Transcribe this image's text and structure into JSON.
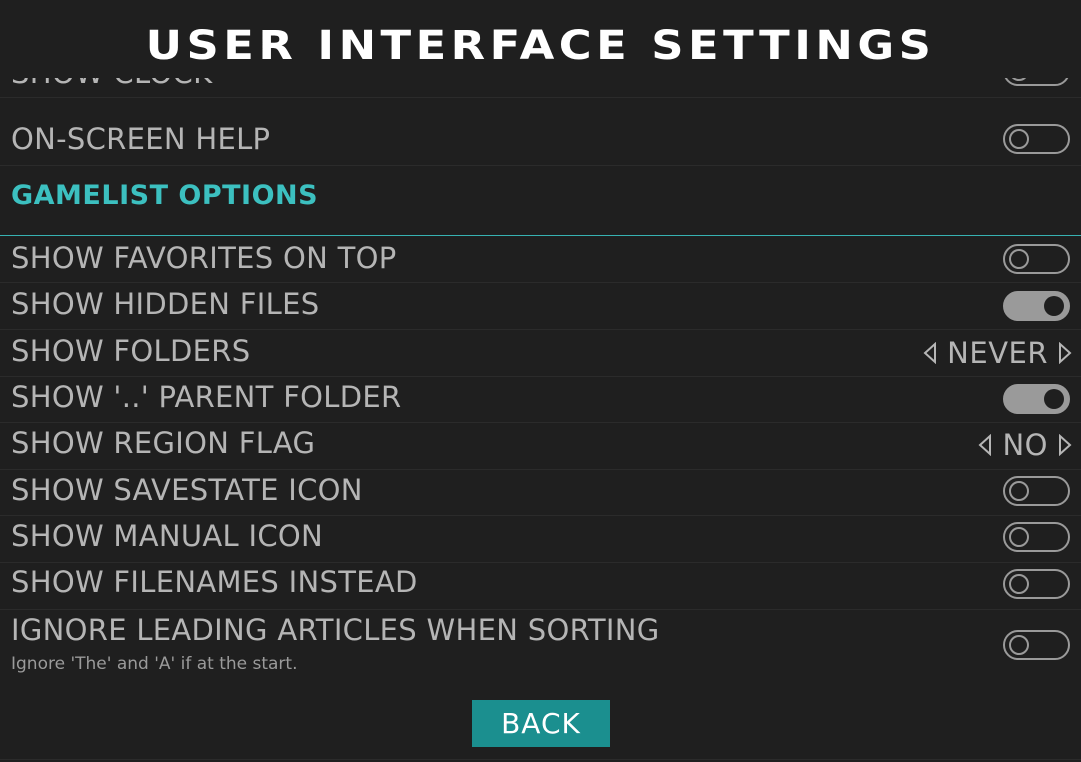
{
  "header": {
    "title": "USER INTERFACE SETTINGS"
  },
  "settings": {
    "partial_row": {
      "label": "SHOW CLOCK",
      "state": "off"
    },
    "on_screen_help": {
      "label": "ON-SCREEN HELP",
      "state": "off"
    },
    "section_title": "GAMELIST OPTIONS",
    "items": [
      {
        "label": "SHOW FAVORITES ON TOP",
        "type": "toggle",
        "state": "off"
      },
      {
        "label": "SHOW HIDDEN FILES",
        "type": "toggle",
        "state": "on"
      },
      {
        "label": "SHOW FOLDERS",
        "type": "selector",
        "value": "NEVER"
      },
      {
        "label": "SHOW '..' PARENT FOLDER",
        "type": "toggle",
        "state": "on"
      },
      {
        "label": "SHOW REGION FLAG",
        "type": "selector",
        "value": "NO"
      },
      {
        "label": "SHOW SAVESTATE ICON",
        "type": "toggle",
        "state": "off"
      },
      {
        "label": "SHOW MANUAL ICON",
        "type": "toggle",
        "state": "off"
      },
      {
        "label": "SHOW FILENAMES INSTEAD",
        "type": "toggle",
        "state": "off"
      },
      {
        "label": "IGNORE LEADING ARTICLES WHEN SORTING",
        "type": "toggle",
        "state": "off",
        "description": "Ignore 'The' and 'A' if at the start."
      }
    ]
  },
  "footer": {
    "back_label": "BACK"
  },
  "colors": {
    "background": "#1f1f1f",
    "accent": "#3cc0c0",
    "button": "#1b8f8f",
    "text": "#b5b5b5"
  }
}
